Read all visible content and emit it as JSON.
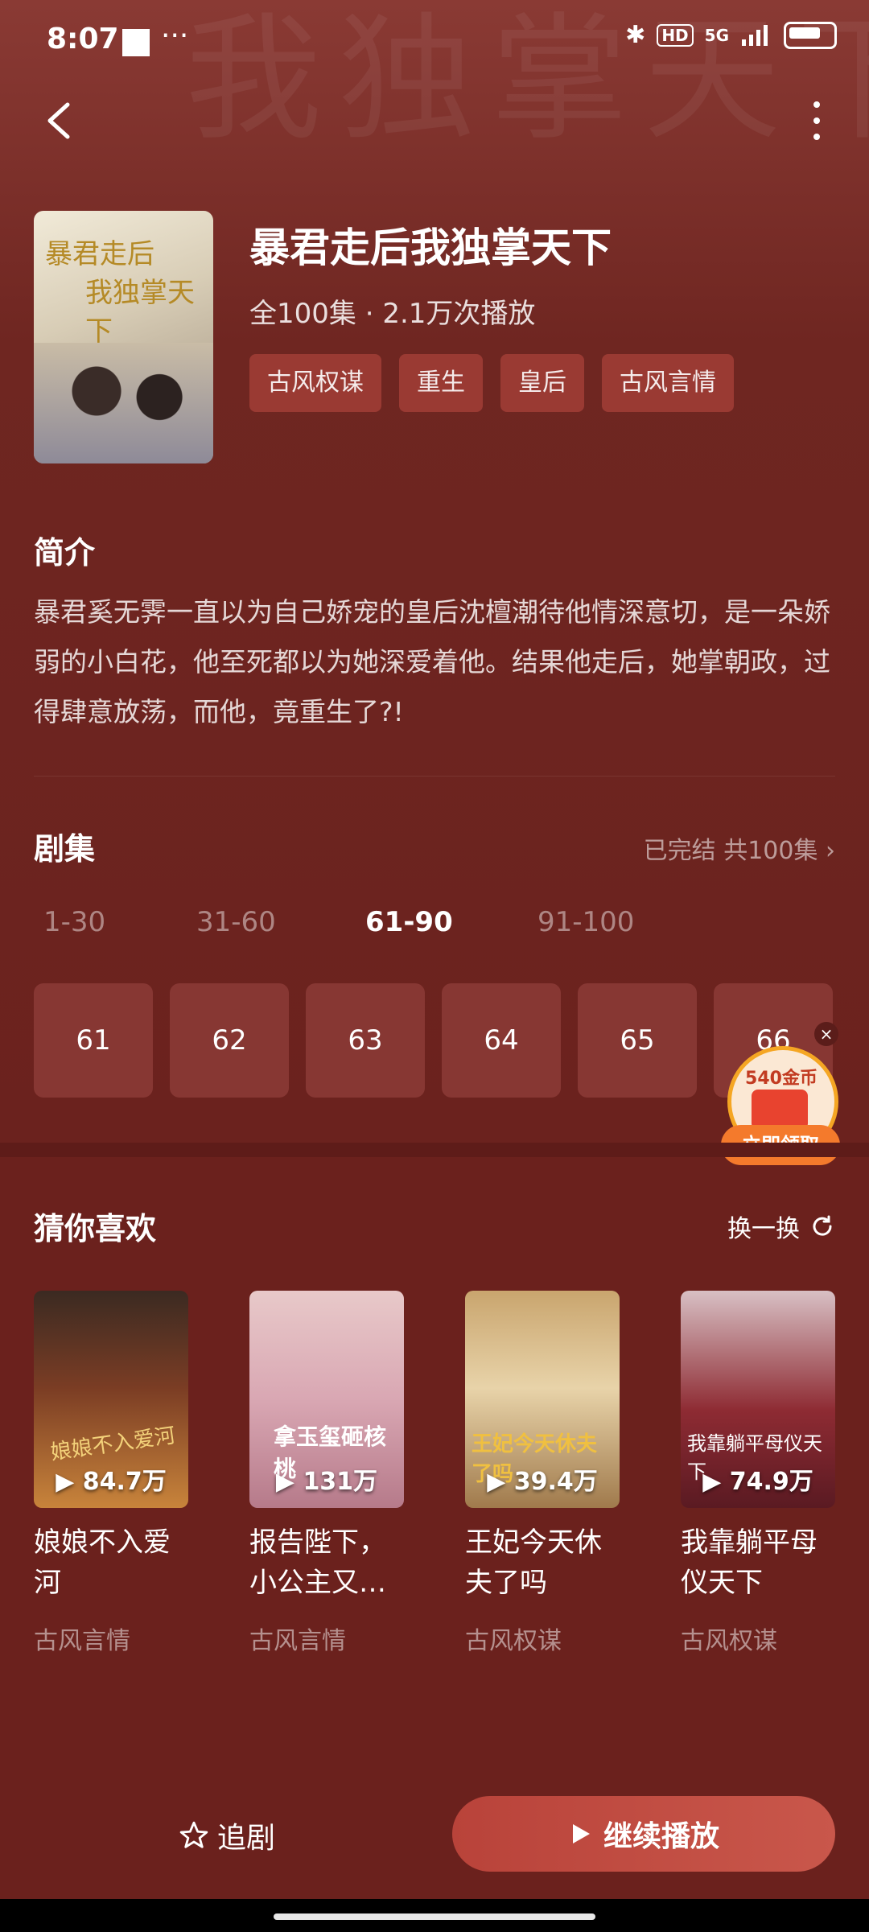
{
  "status_bar": {
    "time": "8:07",
    "dots": "···",
    "hd": "HD",
    "network": "5G"
  },
  "drama": {
    "title": "暴君走后我独掌天下",
    "meta": "全100集 · 2.1万次播放",
    "tags": [
      "古风权谋",
      "重生",
      "皇后",
      "古风言情"
    ],
    "cover_text_line1": "暴君走后",
    "cover_text_line2": "我独掌天下"
  },
  "intro": {
    "heading": "简介",
    "text": "暴君奚无霁一直以为自己娇宠的皇后沈檀潮待他情深意切，是一朵娇弱的小白花，他至死都以为她深爱着他。结果他走后，她掌朝政，过得肆意放荡，而他，竟重生了?!"
  },
  "episodes": {
    "heading": "剧集",
    "status": "已完结 共100集",
    "ranges": [
      "1-30",
      "31-60",
      "61-90",
      "91-100"
    ],
    "active_range": "61-90",
    "items": [
      "61",
      "62",
      "63",
      "64",
      "65",
      "66"
    ]
  },
  "coin_widget": {
    "amount": "540金币",
    "button": "立即领取",
    "close": "×"
  },
  "recommend": {
    "heading": "猜你喜欢",
    "refresh": "换一换",
    "items": [
      {
        "title": "娘娘不入爱河",
        "tag": "古风言情",
        "views": "84.7万",
        "poster_text": "娘娘不入爱河"
      },
      {
        "title": "报告陛下，小公主又…",
        "tag": "古风言情",
        "views": "131万",
        "poster_text": "拿玉玺砸核桃"
      },
      {
        "title": "王妃今天休夫了吗",
        "tag": "古风权谋",
        "views": "39.4万",
        "poster_text": "王妃今天休夫了吗"
      },
      {
        "title": "我靠躺平母仪天下",
        "tag": "古风权谋",
        "views": "74.9万",
        "poster_text": "我靠躺平母仪天下"
      }
    ]
  },
  "bottom": {
    "follow": "追剧",
    "play": "继续播放"
  }
}
